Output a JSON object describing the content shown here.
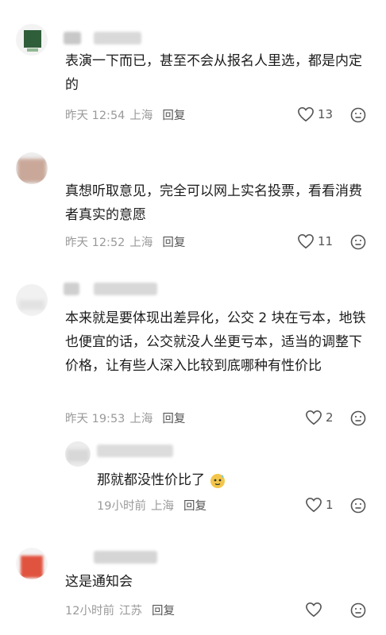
{
  "comments": [
    {
      "text": "表演一下而已，甚至不会从报名人里选，都是内定的",
      "date": "昨天 12:54",
      "location": "上海",
      "reply_label": "回复",
      "likes": "13"
    },
    {
      "text": "真想听取意见，完全可以网上实名投票，看看消费者真实的意愿",
      "date": "昨天 12:52",
      "location": "上海",
      "reply_label": "回复",
      "likes": "11"
    },
    {
      "text": "本来就是要体现出差异化，公交 2 块在亏本，地铁也便宜的话，公交就没人坐更亏本，适当的调整下价格，让有些人深入比较到底哪种有性价比",
      "date": "昨天 19:53",
      "location": "上海",
      "reply_label": "回复",
      "likes": "2"
    },
    {
      "text": "那就都没性价比了",
      "date": "19小时前",
      "location": "上海",
      "reply_label": "回复",
      "likes": "1"
    },
    {
      "text": "这是通知会",
      "date": "12小时前",
      "location": "江苏",
      "reply_label": "回复",
      "likes": ""
    }
  ],
  "colors": {
    "meta": "#9a9a9a",
    "text": "#1c1c1c",
    "icon": "#555555"
  }
}
